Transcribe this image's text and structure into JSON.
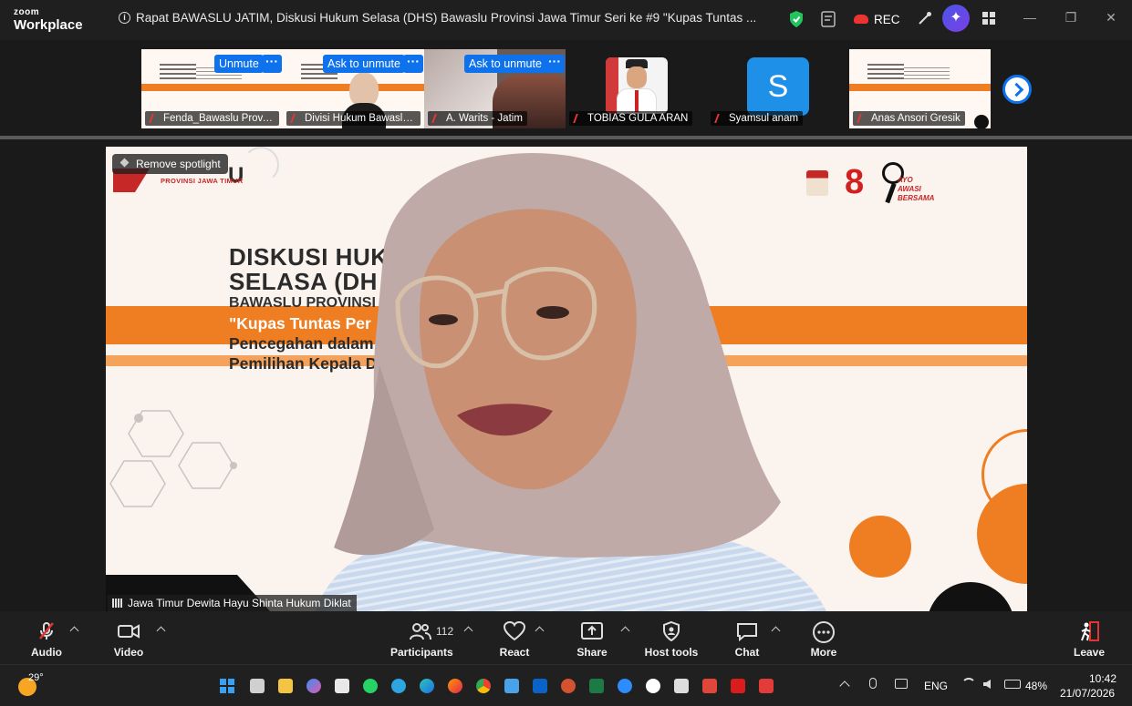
{
  "app": {
    "logo_top": "zoom",
    "logo_bottom": "Workplace",
    "meeting_title": "Rapat BAWASLU JATIM, Diskusi Hukum Selasa (DHS) Bawaslu Provinsi Jawa Timur Seri ke #9 \"Kupas Tuntas ...",
    "rec_label": "REC"
  },
  "thumbnails": [
    {
      "name": "Fenda_Bawaslu Prov. J...",
      "pill": "Unmute"
    },
    {
      "name": "Divisi Hukum Bawaslu ...",
      "pill": "Ask to unmute"
    },
    {
      "name": "A. Warits - Jatim",
      "pill": "Ask to unmute"
    },
    {
      "name": "TOBIAS GULA ARAN"
    },
    {
      "name": "Syamsul anam",
      "avatar_letter": "S"
    },
    {
      "name": "Anas Ansori Gresik"
    }
  ],
  "main": {
    "remove_spotlight": "Remove spotlight",
    "speaker_name": "Jawa Timur Dewita Hayu Shinta Hukum Diklat",
    "slide_title_1": "DISKUSI HUK",
    "slide_title_2": "SELASA (DH",
    "slide_org": "BAWASLU PROVINSI J",
    "slide_q1": "\"Kupas Tuntas Per",
    "slide_q2": "Pencegahan dalam",
    "slide_q3": "Pemilihan Kepala D",
    "logo_text": "PROVINSI JAWA TIMUR",
    "logo_letter": "U",
    "badge_text": "AYO AWASI BERSAMA",
    "badge_number": "8"
  },
  "toolbar": {
    "audio": "Audio",
    "video": "Video",
    "participants": "Participants",
    "participants_count": "112",
    "react": "React",
    "share": "Share",
    "host_tools": "Host tools",
    "chat": "Chat",
    "more": "More",
    "leave": "Leave"
  },
  "taskbar": {
    "weather": "29°",
    "lang": "ENG",
    "battery": "48%",
    "time": "10:42",
    "date": "21/07/2026"
  },
  "colors": {
    "accent_blue": "#0e72ed",
    "slide_orange": "#ef7d22",
    "mute_red": "#e33333"
  }
}
